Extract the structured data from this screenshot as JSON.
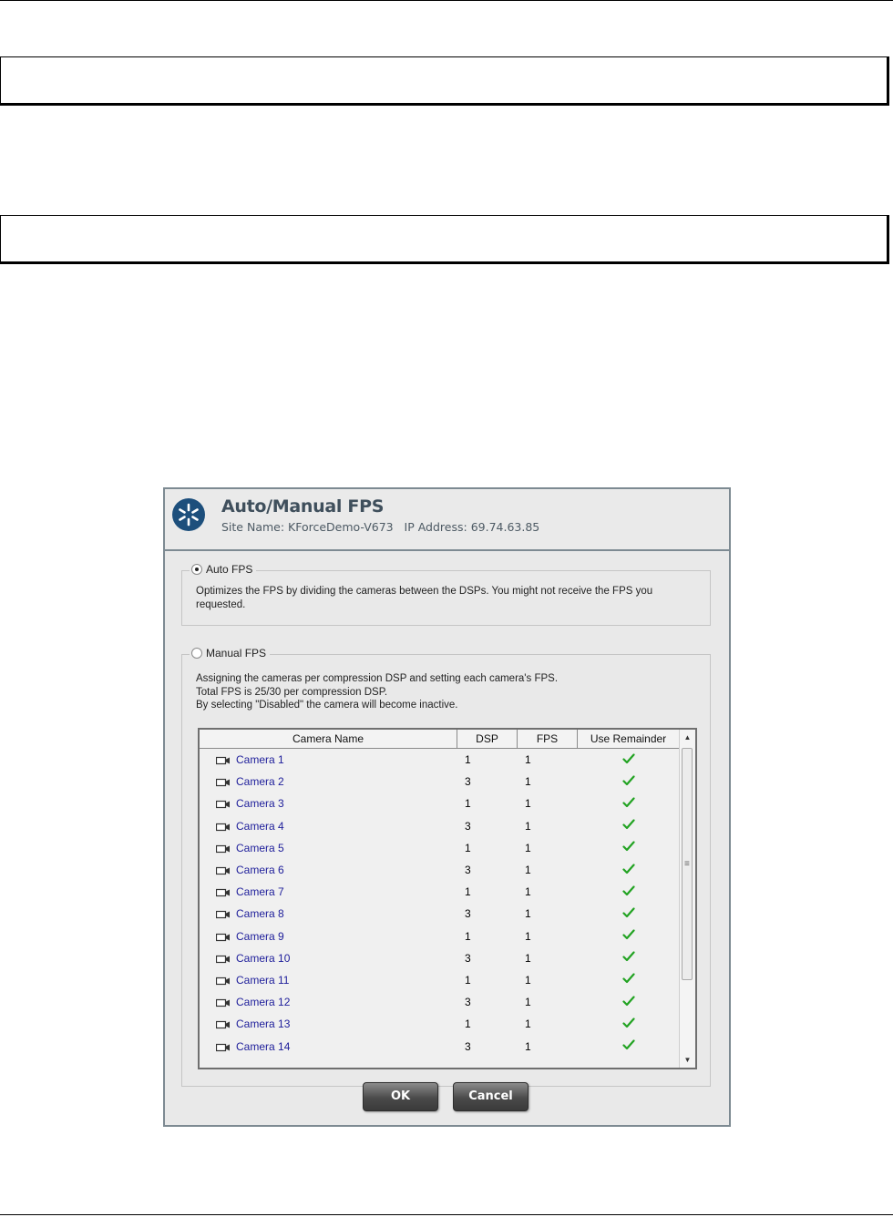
{
  "dialog": {
    "title": "Auto/Manual FPS",
    "subtitle": "Site Name: KForceDemo-V673   IP Address: 69.74.63.85",
    "auto_group": {
      "label": "Auto FPS",
      "selected": true,
      "description": "Optimizes the FPS by dividing the cameras  between the DSPs. You might not receive the FPS you requested."
    },
    "manual_group": {
      "label": "Manual FPS",
      "selected": false,
      "description_lines": [
        "Assigning the cameras per compression DSP and setting each camera's FPS.",
        "Total FPS is 25/30 per compression DSP.",
        "By selecting \"Disabled\" the camera will become inactive."
      ]
    },
    "table": {
      "columns": [
        "Camera Name",
        "DSP",
        "FPS",
        "Use Remainder"
      ],
      "rows": [
        {
          "name": "Camera 1",
          "dsp": "1",
          "fps": "1",
          "use_remainder": true
        },
        {
          "name": "Camera 2",
          "dsp": "3",
          "fps": "1",
          "use_remainder": true
        },
        {
          "name": "Camera 3",
          "dsp": "1",
          "fps": "1",
          "use_remainder": true
        },
        {
          "name": "Camera  4",
          "dsp": "3",
          "fps": "1",
          "use_remainder": true
        },
        {
          "name": "Camera  5",
          "dsp": "1",
          "fps": "1",
          "use_remainder": true
        },
        {
          "name": "Camera  6",
          "dsp": "3",
          "fps": "1",
          "use_remainder": true
        },
        {
          "name": "Camera  7",
          "dsp": "1",
          "fps": "1",
          "use_remainder": true
        },
        {
          "name": "Camera  8",
          "dsp": "3",
          "fps": "1",
          "use_remainder": true
        },
        {
          "name": "Camera  9",
          "dsp": "1",
          "fps": "1",
          "use_remainder": true
        },
        {
          "name": "Camera 10",
          "dsp": "3",
          "fps": "1",
          "use_remainder": true
        },
        {
          "name": "Camera 11",
          "dsp": "1",
          "fps": "1",
          "use_remainder": true
        },
        {
          "name": "Camera 12",
          "dsp": "3",
          "fps": "1",
          "use_remainder": true
        },
        {
          "name": "Camera 13",
          "dsp": "1",
          "fps": "1",
          "use_remainder": true
        },
        {
          "name": "Camera 14",
          "dsp": "3",
          "fps": "1",
          "use_remainder": true
        }
      ],
      "row_icon": "camera-icon",
      "check_icon": "checkmark-icon"
    },
    "buttons": {
      "ok": "OK",
      "cancel": "Cancel"
    },
    "colors": {
      "camera_name": "#1d1d9a",
      "checkmark": "#22a322",
      "logo": "#1d4f7c"
    }
  }
}
